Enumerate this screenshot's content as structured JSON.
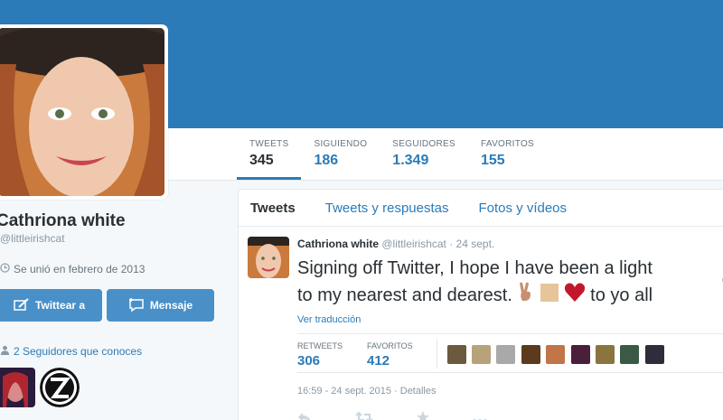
{
  "stats": [
    {
      "label": "TWEETS",
      "value": "345"
    },
    {
      "label": "SIGUIENDO",
      "value": "186"
    },
    {
      "label": "SEGUIDORES",
      "value": "1.349"
    },
    {
      "label": "FAVORITOS",
      "value": "155"
    }
  ],
  "profile": {
    "name": "Cathriona white",
    "handle": "@littleirishcat",
    "joined": "Se unió en febrero de 2013",
    "tweet_button": "Twittear a",
    "message_button": "Mensaje",
    "followers_you_know": "2 Seguidores que conoces"
  },
  "tabs": [
    "Tweets",
    "Tweets y respuestas",
    "Fotos y vídeos"
  ],
  "tweet": {
    "author": "Cathriona white",
    "meta": "@littleirishcat · 24 sept.",
    "text_line1": "Signing off Twitter, I hope I have been a light",
    "text_line2_start": "to my nearest and dearest.",
    "text_line2_end": "to yo all",
    "translate": "Ver traducción",
    "retweets_label": "RETWEETS",
    "retweets": "306",
    "favorites_label": "FAVORITOS",
    "favorites": "412",
    "timestamp": "16:59 - 24 sept. 2015 · Detalles"
  },
  "colors": {
    "banner": "#2b7bb9",
    "accent": "#2b7bb9"
  }
}
